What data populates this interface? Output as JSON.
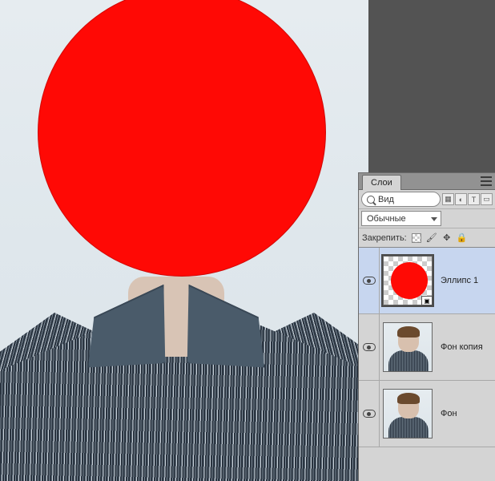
{
  "panel": {
    "tab_label": "Слои",
    "filter_text": "Вид",
    "blend_mode": "Обычные",
    "lock_label": "Закрепить:"
  },
  "layers": [
    {
      "name": "Эллипс 1",
      "selected": true,
      "type": "shape"
    },
    {
      "name": "Фон копия",
      "selected": false,
      "type": "raster"
    },
    {
      "name": "Фон",
      "selected": false,
      "type": "raster"
    }
  ]
}
